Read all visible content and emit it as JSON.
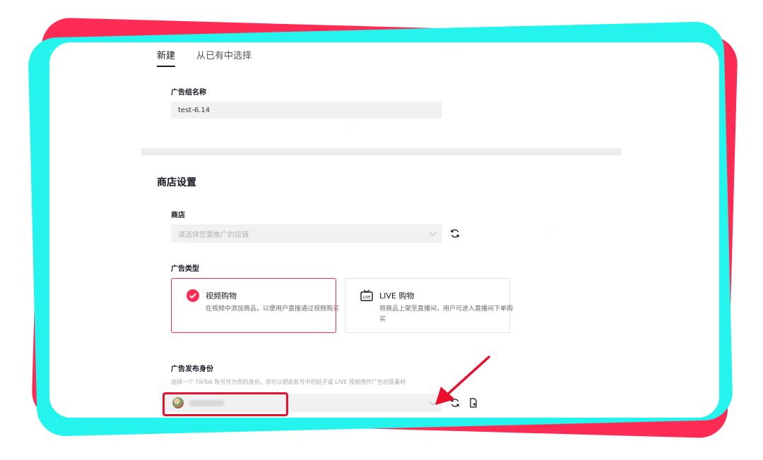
{
  "tabs": [
    {
      "label": "新建",
      "active": true
    },
    {
      "label": "从已有中选择",
      "active": false
    }
  ],
  "ad_group": {
    "label": "广告组名称",
    "value": "test-6.14"
  },
  "shop_settings": {
    "title": "商店设置",
    "shop_label": "商店",
    "shop_placeholder": "请选择您要推广的店铺"
  },
  "ad_type": {
    "label": "广告类型",
    "options": [
      {
        "title": "视频购物",
        "description": "在视频中添加商品，以便用户直接通过视频购买",
        "selected": true,
        "icon": "check-circle-icon"
      },
      {
        "title": "LIVE 购物",
        "description": "将商品上架至直播间，用户可进入直播间下单购买",
        "selected": false,
        "icon": "live-tv-icon"
      }
    ]
  },
  "identity": {
    "label": "广告发布身份",
    "hint": "选择一个 TikTok 账号作为您的身份。您可以把此账号中的帖子或 LIVE 视频用作广告创意素材"
  },
  "colors": {
    "accent": "#fe2c55",
    "frame_cyan": "#25f4ee",
    "highlight": "#e8102d"
  }
}
